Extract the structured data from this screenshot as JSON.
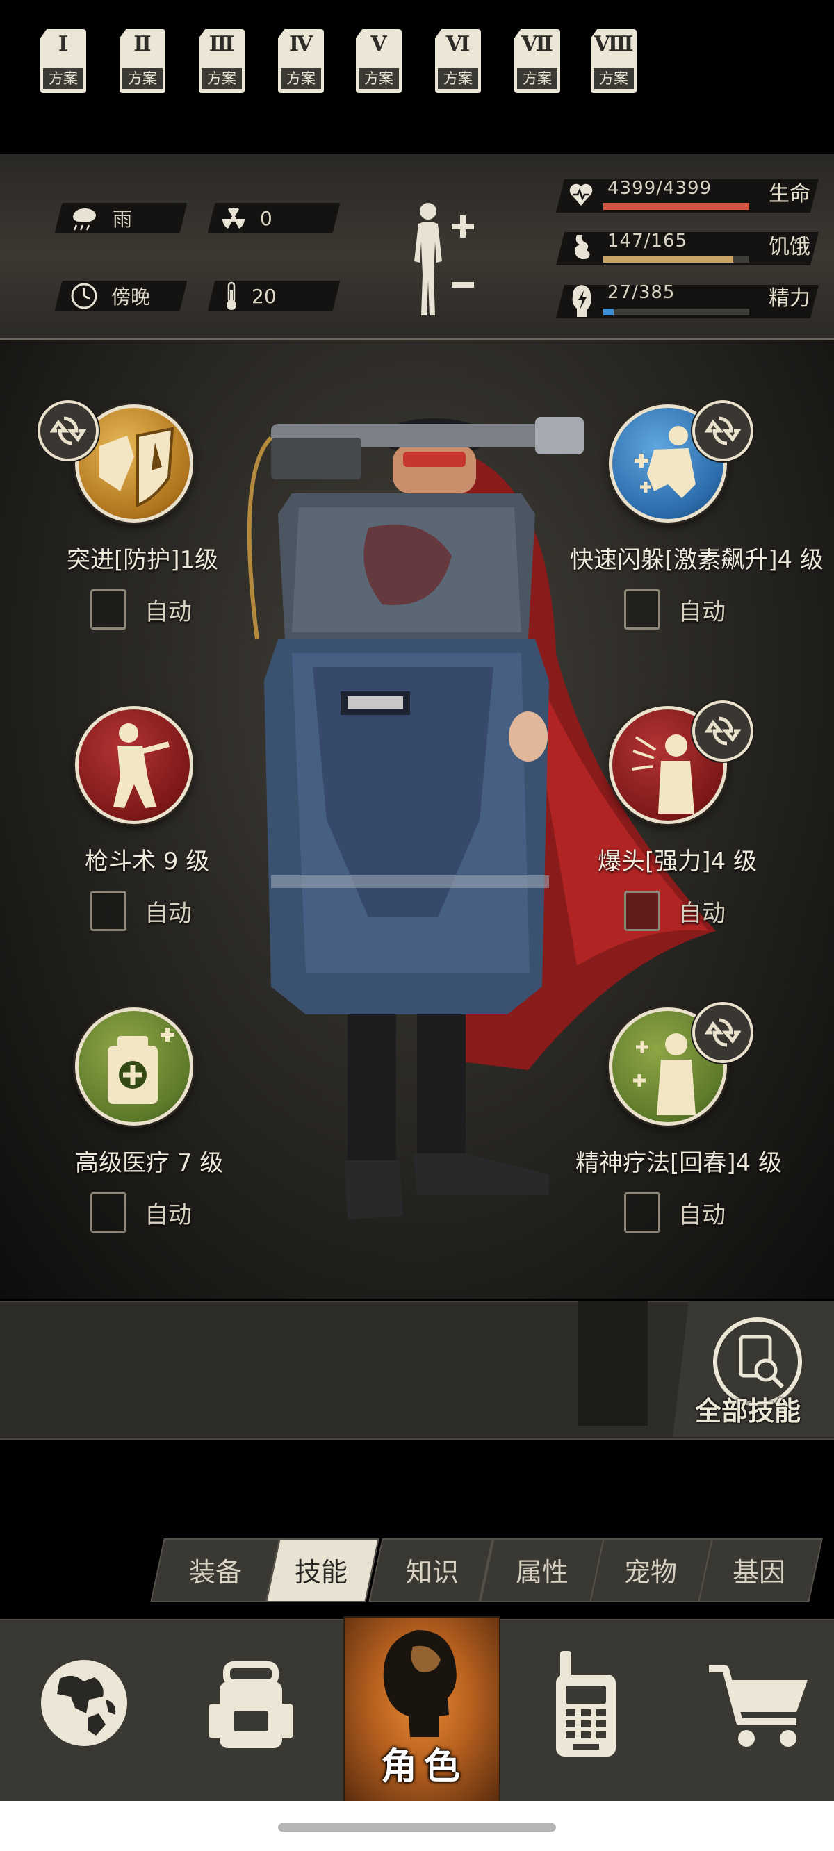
{
  "status": {
    "weather": "雨",
    "radiation": "0",
    "time_of_day": "傍晚",
    "temperature": "20",
    "health": {
      "text": "4399/4399",
      "label": "生命",
      "fraction": 1.0,
      "color": "#d4553f"
    },
    "hunger": {
      "text": "147/165",
      "label": "饥饿",
      "fraction": 0.89,
      "color": "#c9a469"
    },
    "energy": {
      "text": "27/385",
      "label": "精力",
      "fraction": 0.07,
      "color": "#3d8fd6"
    }
  },
  "skills": [
    {
      "name": "突进[防护]1级",
      "auto": "自动",
      "swappable": true,
      "icon": "shield-charge-icon",
      "color": "#c48a2c"
    },
    {
      "name": "快速闪躲[激素飙升]4 级",
      "auto": "自动",
      "swappable": true,
      "icon": "dodge-icon",
      "color": "#2f6ca8"
    },
    {
      "name": "枪斗术 9 级",
      "auto": "自动",
      "swappable": false,
      "icon": "gun-fu-icon",
      "color": "#8c1e1e"
    },
    {
      "name": "爆头[强力]4 级",
      "auto": "自动",
      "swappable": true,
      "icon": "headshot-icon",
      "color": "#8c1e1e"
    },
    {
      "name": "高级医疗 7 级",
      "auto": "自动",
      "swappable": false,
      "icon": "medical-kit-icon",
      "color": "#5c7a2a"
    },
    {
      "name": "精神疗法[回春]4 级",
      "auto": "自动",
      "swappable": true,
      "icon": "therapy-icon",
      "color": "#5c7a2a"
    }
  ],
  "plans": {
    "label": "方案",
    "numerals": [
      "Ⅰ",
      "Ⅱ",
      "Ⅲ",
      "Ⅳ",
      "Ⅴ",
      "Ⅵ",
      "Ⅶ",
      "Ⅷ"
    ],
    "selected": "Ⅷ"
  },
  "all_skills_label": "全部技能",
  "tabs": [
    "装备",
    "技能",
    "知识",
    "属性",
    "宠物",
    "基因"
  ],
  "active_tab": "技能",
  "nav": {
    "role_label": "角色"
  }
}
